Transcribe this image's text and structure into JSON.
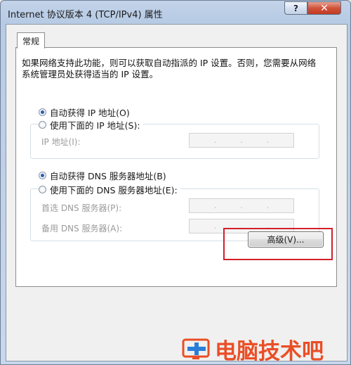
{
  "window": {
    "title": "Internet 协议版本 4 (TCP/IPv4) 属性",
    "help_label": "?",
    "close_label": "✕"
  },
  "tabs": [
    {
      "label": "常规",
      "selected": true
    }
  ],
  "description": "如果网络支持此功能，则可以获取自动指派的 IP 设置。否则，您需要从网络系统管理员处获得适当的 IP 设置。",
  "ip_section": {
    "auto_label": "自动获得 IP 地址(O)",
    "auto_selected": true,
    "manual_label": "使用下面的 IP 地址(S):",
    "manual_selected": false,
    "fields": [
      {
        "label": "IP 地址(I):",
        "value": ". . ."
      }
    ]
  },
  "dns_section": {
    "auto_label": "自动获得 DNS 服务器地址(B)",
    "auto_selected": true,
    "manual_label": "使用下面的 DNS 服务器地址(E):",
    "manual_selected": false,
    "fields": [
      {
        "label": "首选 DNS 服务器(P):",
        "value": ". . ."
      },
      {
        "label": "备用 DNS 服务器(A):",
        "value": ". . ."
      }
    ]
  },
  "advanced_button": {
    "label": "高级(V)..."
  },
  "highlight_color": "#d2202a",
  "watermark": {
    "text": "电脑技术吧",
    "color": "#ea4e26"
  }
}
